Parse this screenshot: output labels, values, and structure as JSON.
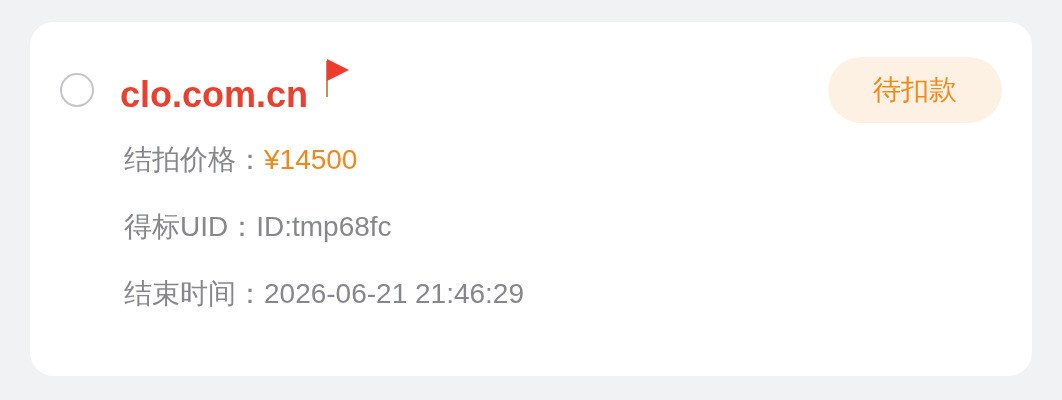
{
  "order": {
    "selected": false,
    "domain": "clo.com.cn",
    "flagged": true,
    "status": "待扣款",
    "fields": [
      {
        "label": "结拍价格：",
        "value": "¥14500",
        "kind": "price"
      },
      {
        "label": "得标UID：",
        "value": "ID:tmp68fc",
        "kind": "plain"
      },
      {
        "label": "结束时间：",
        "value": "2026-06-21 21:46:29",
        "kind": "plain"
      }
    ]
  }
}
